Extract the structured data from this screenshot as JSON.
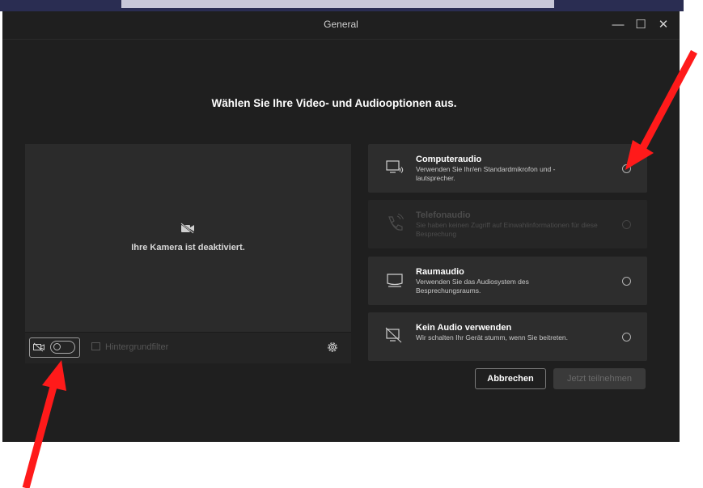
{
  "window": {
    "title": "General",
    "controls": [
      "—",
      "☐",
      "✕"
    ]
  },
  "heading": "Wählen Sie Ihre Video- und Audiooptionen aus.",
  "video": {
    "camera_status": "Ihre Kamera ist deaktiviert.",
    "camera_toggle_on": false,
    "background_filter_label": "Hintergrundfilter"
  },
  "audio_options": [
    {
      "title": "Computeraudio",
      "description": "Verwenden Sie Ihr/en Standardmikrofon und -lautsprecher.",
      "icon": "computer-audio-icon",
      "enabled": true
    },
    {
      "title": "Telefonaudio",
      "description": "Sie haben keinen Zugriff auf Einwahlinformationen für diese Besprechung",
      "icon": "phone-audio-icon",
      "enabled": false
    },
    {
      "title": "Raumaudio",
      "description": "Verwenden Sie das Audiosystem des Besprechungsraums.",
      "icon": "room-audio-icon",
      "enabled": true
    },
    {
      "title": "Kein Audio verwenden",
      "description": "Wir schalten Ihr Gerät stumm, wenn Sie beitreten.",
      "icon": "no-audio-icon",
      "enabled": true
    }
  ],
  "buttons": {
    "cancel": "Abbrechen",
    "join": "Jetzt teilnehmen"
  },
  "colors": {
    "background": "#1f1f1f",
    "panel": "#2d2d2d",
    "annotation_arrow": "#ff1a1a"
  }
}
